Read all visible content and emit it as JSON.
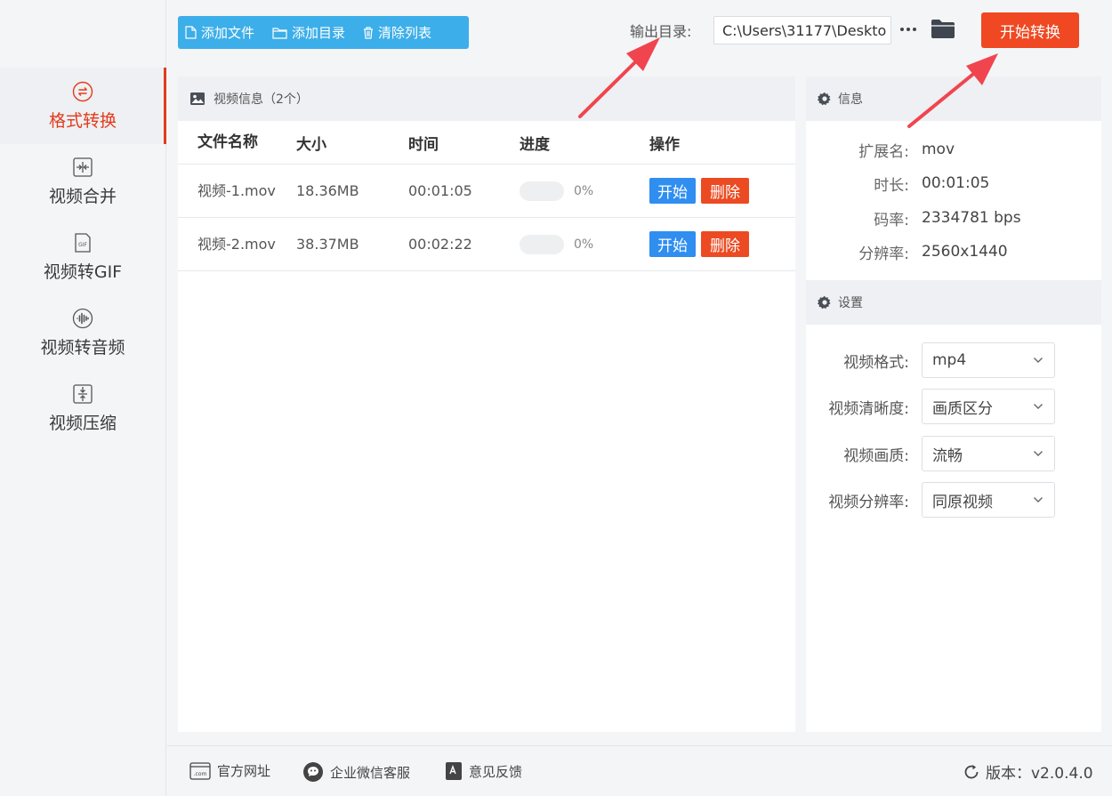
{
  "sidebar": {
    "items": [
      {
        "label": "格式转换",
        "icon": "convert-icon",
        "active": true
      },
      {
        "label": "视频合并",
        "icon": "merge-icon"
      },
      {
        "label": "视频转GIF",
        "icon": "gif-icon"
      },
      {
        "label": "视频转音频",
        "icon": "audio-icon"
      },
      {
        "label": "视频压缩",
        "icon": "compress-icon"
      }
    ]
  },
  "toolbar": {
    "add_file": "添加文件",
    "add_folder": "添加目录",
    "clear_list": "清除列表"
  },
  "output": {
    "label": "输出目录:",
    "path": "C:\\Users\\31177\\Deskto",
    "start_all": "开始转换"
  },
  "file_panel": {
    "title": "视频信息（2个）",
    "columns": {
      "name": "文件名称",
      "size": "大小",
      "time": "时间",
      "progress": "进度",
      "ops": "操作"
    },
    "rows": [
      {
        "name": "视频-1.mov",
        "size": "18.36MB",
        "time": "00:01:05",
        "progress_label": "0%",
        "progress": 0,
        "start": "开始",
        "delete": "删除"
      },
      {
        "name": "视频-2.mov",
        "size": "38.37MB",
        "time": "00:02:22",
        "progress_label": "0%",
        "progress": 0,
        "start": "开始",
        "delete": "删除"
      }
    ]
  },
  "info": {
    "title": "信息",
    "ext_label": "扩展名:",
    "ext": "mov",
    "duration_label": "时长:",
    "duration": "00:01:05",
    "bitrate_label": "码率:",
    "bitrate": "2334781 bps",
    "resolution_label": "分辨率:",
    "resolution": "2560x1440"
  },
  "settings": {
    "title": "设置",
    "format_label": "视频格式:",
    "format": "mp4",
    "clarity_label": "视频清晰度:",
    "clarity": "画质区分",
    "quality_label": "视频画质:",
    "quality": "流畅",
    "resolution_label": "视频分辨率:",
    "resolution": "同原视频"
  },
  "footer": {
    "website": "官方网址",
    "wechat": "企业微信客服",
    "feedback": "意见反馈",
    "version": "版本：v2.0.4.0"
  },
  "colors": {
    "accent": "#ef4822",
    "toolbar": "#3caee9",
    "start_btn": "#2f8ef0",
    "annotation_arrow": "#f0454f"
  }
}
